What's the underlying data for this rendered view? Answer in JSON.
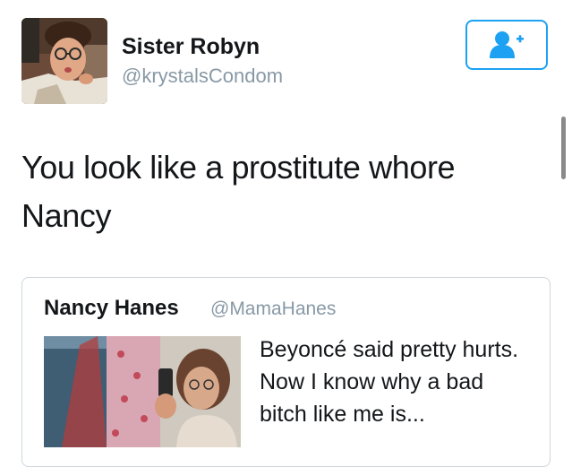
{
  "author": {
    "display_name": "Sister Robyn",
    "handle": "@krystalsCondom",
    "avatar_icon": "profile-photo"
  },
  "follow_button": {
    "icon": "add-user-icon",
    "color": "#1da1f2"
  },
  "tweet": {
    "text": "You look like a prostitute whore Nancy"
  },
  "quoted_tweet": {
    "display_name": "Nancy Hanes",
    "handle": "@MamaHanes",
    "text": "Beyoncé said pretty hurts. Now I know why a bad bitch like me is...",
    "media_icon": "selfie-photo"
  },
  "colors": {
    "accent": "#1da1f2",
    "secondary_text": "#8899a6",
    "border": "#ccd6dd"
  }
}
